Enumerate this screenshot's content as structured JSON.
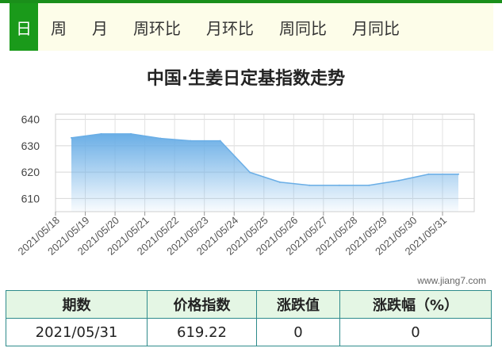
{
  "tabs": [
    {
      "label": "日",
      "active": true
    },
    {
      "label": "周",
      "active": false
    },
    {
      "label": "月",
      "active": false
    },
    {
      "label": "周环比",
      "active": false
    },
    {
      "label": "月环比",
      "active": false
    },
    {
      "label": "周同比",
      "active": false
    },
    {
      "label": "月同比",
      "active": false
    }
  ],
  "watermark": "www.jiang7.com",
  "colors": {
    "accent_green": "#1a9a1a",
    "line": "#6aaee6",
    "area_top": "#6aaee6",
    "table_border": "#2e8b8b",
    "header_bg": "#e4f6e4"
  },
  "chart_data": {
    "type": "area",
    "title": "中国·生姜日定基指数走势",
    "xlabel": "",
    "ylabel": "",
    "ylim": [
      605,
      642
    ],
    "yticks": [
      610,
      620,
      630,
      640
    ],
    "grid": true,
    "categories": [
      "2021/05/18",
      "2021/05/19",
      "2021/05/20",
      "2021/05/21",
      "2021/05/22",
      "2021/05/23",
      "2021/05/24",
      "2021/05/25",
      "2021/05/26",
      "2021/05/27",
      "2021/05/28",
      "2021/05/29",
      "2021/05/30",
      "2021/05/31"
    ],
    "series": [
      {
        "values": [
          633.0,
          634.5,
          634.5,
          632.8,
          631.9,
          631.9,
          619.9,
          616.2,
          615.0,
          615.0,
          615.0,
          616.8,
          619.22,
          619.22
        ]
      }
    ]
  },
  "table": {
    "headers": [
      "期数",
      "价格指数",
      "涨跌值",
      "涨跌幅（%）"
    ],
    "row": [
      "2021/05/31",
      "619.22",
      "0",
      "0"
    ]
  }
}
